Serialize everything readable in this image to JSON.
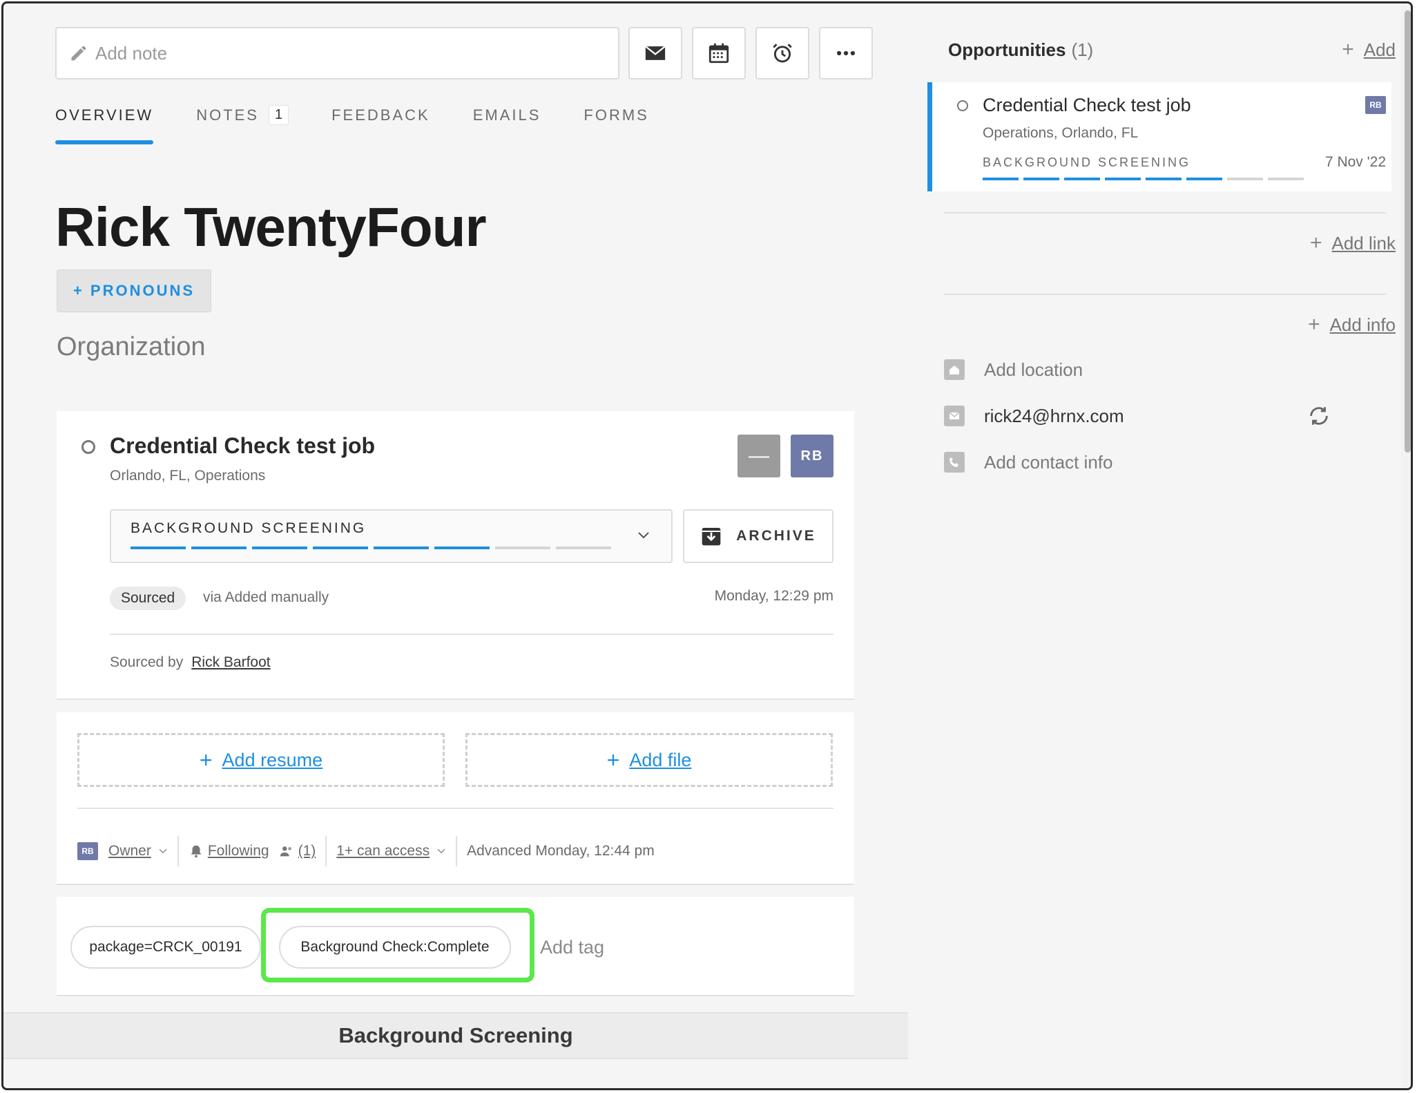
{
  "toolbar": {
    "note_placeholder": "Add note",
    "icons": [
      "envelope-icon",
      "calendar-icon",
      "alarm-clock-icon",
      "more-dots-icon"
    ]
  },
  "tabs": [
    {
      "label": "OVERVIEW",
      "active": true
    },
    {
      "label": "NOTES",
      "count": "1"
    },
    {
      "label": "FEEDBACK"
    },
    {
      "label": "EMAILS"
    },
    {
      "label": "FORMS"
    }
  ],
  "candidate": {
    "name": "Rick TwentyFour",
    "pronouns_button": "+ PRONOUNS",
    "organization": "Organization"
  },
  "job_card": {
    "title": "Credential Check test job",
    "location": "Orlando, FL, Operations",
    "minus_label": "—",
    "owner_initials": "RB",
    "stage": "BACKGROUND SCREENING",
    "stage_progress": {
      "completed": 6,
      "total": 8
    },
    "archive_label": "ARCHIVE",
    "source_pill": "Sourced",
    "via": "via Added manually",
    "date": "Monday, 12:29 pm",
    "sourced_by_label": "Sourced by",
    "sourced_by_name": "Rick Barfoot"
  },
  "files": {
    "add_resume": "Add resume",
    "add_file": "Add file",
    "owner_initials": "RB",
    "owner_label": "Owner",
    "following_label": "Following",
    "followers_count": "(1)",
    "access_label": "1+ can access",
    "advanced": "Advanced Monday, 12:44 pm"
  },
  "tags": {
    "items": [
      "package=CRCK_00191",
      "Background Check:Complete"
    ],
    "highlighted_tag": "Background Check:Complete",
    "highlight_color": "#5be84a",
    "add_placeholder": "Add tag"
  },
  "section_title": "Background Screening",
  "opportunities": {
    "heading": "Opportunities",
    "count": "(1)",
    "add_label": "Add",
    "card": {
      "title": "Credential Check test job",
      "location": "Operations, Orlando, FL",
      "stage": "BACKGROUND SCREENING",
      "date": "7 Nov '22",
      "owner_initials": "RB",
      "stage_progress": {
        "completed": 6,
        "total": 8
      }
    }
  },
  "right": {
    "add_link": "Add link",
    "add_info": "Add info",
    "location": "Add location",
    "email": "rick24@hrnx.com",
    "contact": "Add contact info"
  },
  "colors": {
    "accent": "#1e8fe1",
    "avatar": "#6f7aa8"
  }
}
